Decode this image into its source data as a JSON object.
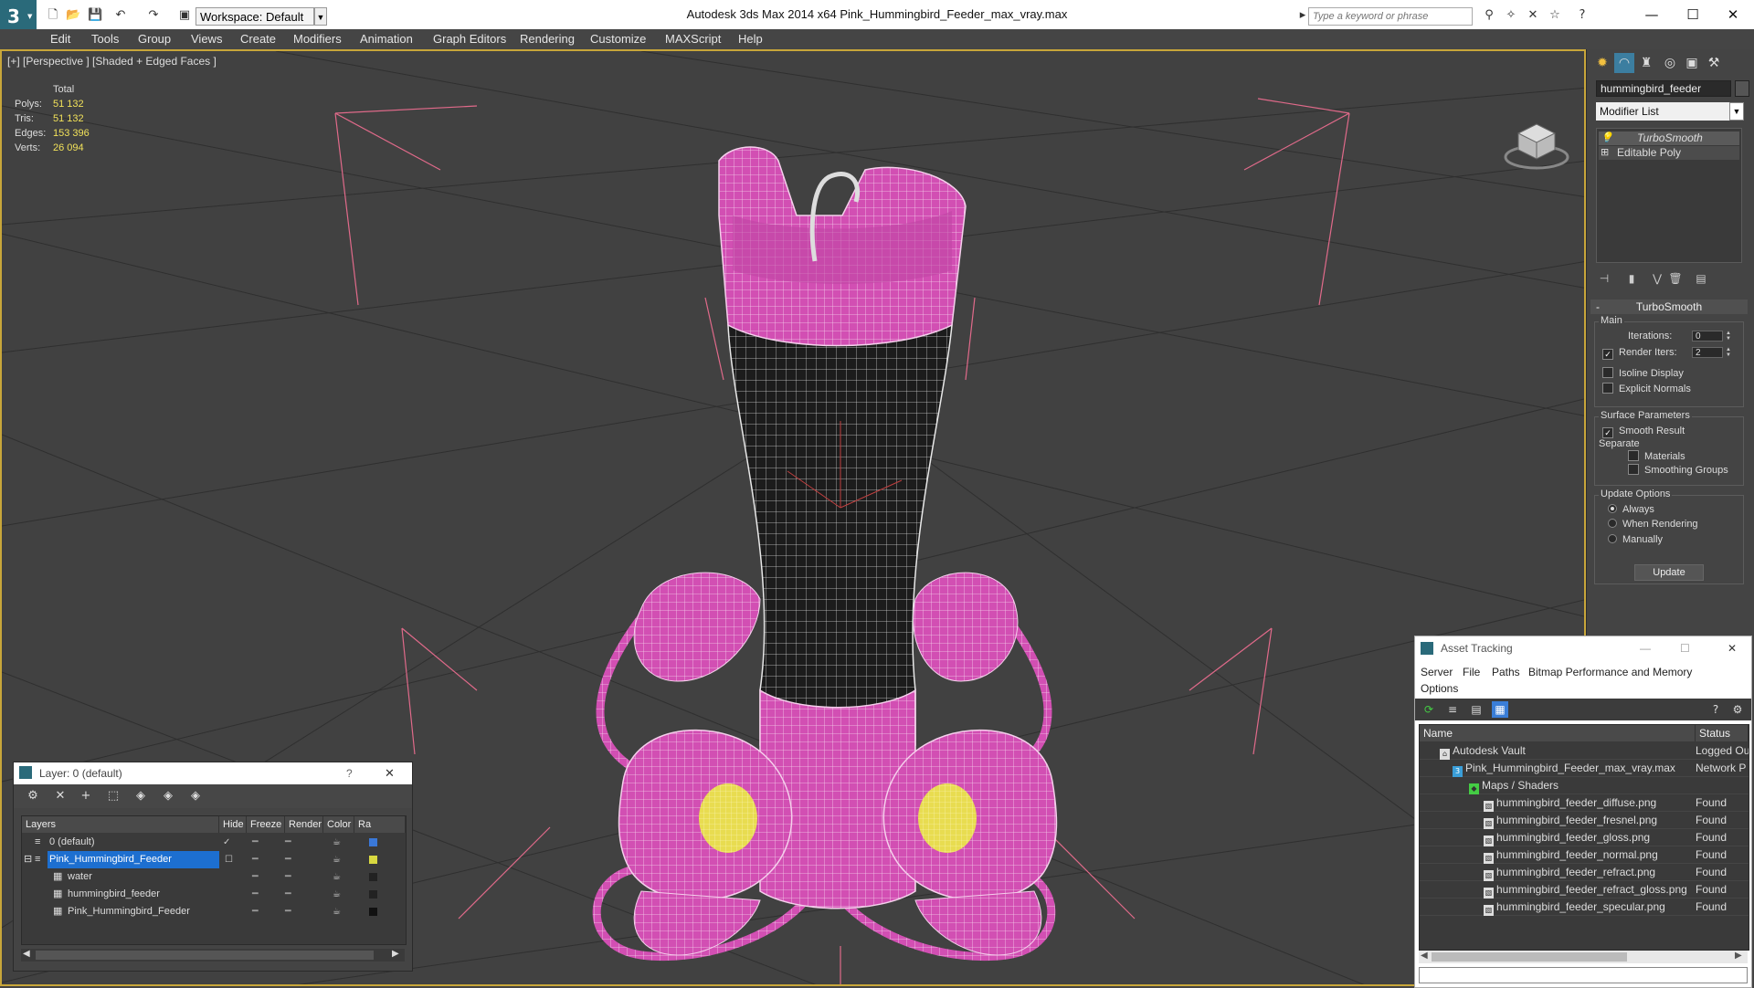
{
  "titlebar": {
    "workspace_label": "Workspace: Default",
    "app_title": "Autodesk 3ds Max  2014 x64       Pink_Hummingbird_Feeder_max_vray.max",
    "search_placeholder": "Type a keyword or phrase",
    "minimize": "—",
    "maximize": "☐",
    "close": "✕"
  },
  "menu": [
    "Edit",
    "Tools",
    "Group",
    "Views",
    "Create",
    "Modifiers",
    "Animation",
    "Graph Editors",
    "Rendering",
    "Customize",
    "MAXScript",
    "Help"
  ],
  "viewport": {
    "label": "[+] [Perspective ] [Shaded + Edged Faces ]",
    "stats_header": "Total",
    "stats": [
      {
        "label": "Polys:",
        "value": "51 132"
      },
      {
        "label": "Tris:",
        "value": "51 132"
      },
      {
        "label": "Edges:",
        "value": "153 396"
      },
      {
        "label": "Verts:",
        "value": "26 094"
      }
    ],
    "colors": {
      "mesh": "#d24fb3",
      "mesh_dark": "#1c1c1c",
      "wire": "#f5d0ec",
      "yellow": "#e8dc50",
      "bbox": "#e06a8a",
      "grid": "#2e2e2e"
    }
  },
  "command_panel": {
    "object_name": "hummingbird_feeder",
    "modifier_list": "Modifier List",
    "stack": [
      "TurboSmooth",
      "Editable Poly"
    ],
    "turbosmooth": {
      "title": "TurboSmooth",
      "main_label": "Main",
      "iterations_label": "Iterations:",
      "iterations_value": "0",
      "render_iters_label": "Render Iters:",
      "render_iters_value": "2",
      "isoline_label": "Isoline Display",
      "explicit_label": "Explicit Normals",
      "surface_label": "Surface Parameters",
      "smooth_result_label": "Smooth Result",
      "separate_label": "Separate",
      "materials_label": "Materials",
      "smoothing_label": "Smoothing Groups",
      "update_options_label": "Update Options",
      "always_label": "Always",
      "when_rendering_label": "When Rendering",
      "manually_label": "Manually",
      "update_button": "Update"
    }
  },
  "layer_dialog": {
    "title": "Layer: 0 (default)",
    "help": "?",
    "close": "✕",
    "columns": [
      "Layers",
      "Hide",
      "Freeze",
      "Render",
      "Color",
      "Ra"
    ],
    "rows": [
      {
        "name": "0 (default)",
        "color": "#3a78d8"
      },
      {
        "name": "Pink_Hummingbird_Feeder",
        "color": "#d8d840"
      },
      {
        "name": "water",
        "color": "#222222"
      },
      {
        "name": "hummingbird_feeder",
        "color": "#222222"
      },
      {
        "name": "Pink_Hummingbird_Feeder",
        "color": "#111111"
      }
    ]
  },
  "asset_tracking": {
    "title": "Asset Tracking",
    "menu": [
      "Server",
      "File",
      "Paths",
      "Bitmap Performance and Memory",
      "Options"
    ],
    "columns": [
      "Name",
      "Status"
    ],
    "rows": [
      {
        "name": "Autodesk Vault",
        "status": "Logged Ou"
      },
      {
        "name": "Pink_Hummingbird_Feeder_max_vray.max",
        "status": "Network P"
      },
      {
        "name": "Maps / Shaders",
        "status": ""
      },
      {
        "name": "hummingbird_feeder_diffuse.png",
        "status": "Found"
      },
      {
        "name": "hummingbird_feeder_fresnel.png",
        "status": "Found"
      },
      {
        "name": "hummingbird_feeder_gloss.png",
        "status": "Found"
      },
      {
        "name": "hummingbird_feeder_normal.png",
        "status": "Found"
      },
      {
        "name": "hummingbird_feeder_refract.png",
        "status": "Found"
      },
      {
        "name": "hummingbird_feeder_refract_gloss.png",
        "status": "Found"
      },
      {
        "name": "hummingbird_feeder_specular.png",
        "status": "Found"
      }
    ]
  }
}
